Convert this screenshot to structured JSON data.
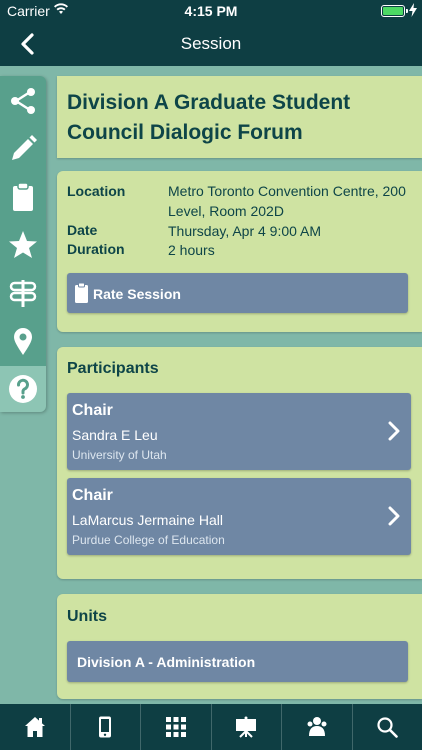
{
  "status_bar": {
    "carrier": "Carrier",
    "time": "4:15 PM"
  },
  "nav": {
    "title": "Session"
  },
  "sidebar": {
    "items": [
      {
        "icon": "share-icon"
      },
      {
        "icon": "pencil-icon"
      },
      {
        "icon": "clipboard-icon"
      },
      {
        "icon": "star-icon"
      },
      {
        "icon": "signpost-icon"
      },
      {
        "icon": "map-pin-icon"
      },
      {
        "icon": "help-icon",
        "active": true
      }
    ]
  },
  "session": {
    "title": "Division A Graduate Student Council Dialogic Forum",
    "location_label": "Location",
    "location_value": "Metro Toronto Convention Centre, 200 Level, Room 202D",
    "date_label": "Date",
    "date_value": "Thursday, Apr 4 9:00 AM",
    "duration_label": "Duration",
    "duration_value": "2 hours",
    "rate_label": "Rate Session"
  },
  "participants": {
    "heading": "Participants",
    "items": [
      {
        "role": "Chair",
        "name": "Sandra E Leu",
        "institution": "University of Utah"
      },
      {
        "role": "Chair",
        "name": "LaMarcus Jermaine Hall",
        "institution": "Purdue College of Education"
      }
    ]
  },
  "units": {
    "heading": "Units",
    "items": [
      {
        "label": "Division A - Administration"
      }
    ]
  },
  "tabbar": {
    "items": [
      {
        "icon": "home-icon"
      },
      {
        "icon": "mobile-icon"
      },
      {
        "icon": "grid-icon"
      },
      {
        "icon": "presentation-icon"
      },
      {
        "icon": "people-icon"
      },
      {
        "icon": "search-icon"
      }
    ]
  },
  "colors": {
    "dark_bar": "#0e3e43",
    "background": "#7fb7a8",
    "card": "#cfe3a2",
    "button": "#6f87a4",
    "sidebar": "#58a08c",
    "heading_text": "#0e4548"
  }
}
